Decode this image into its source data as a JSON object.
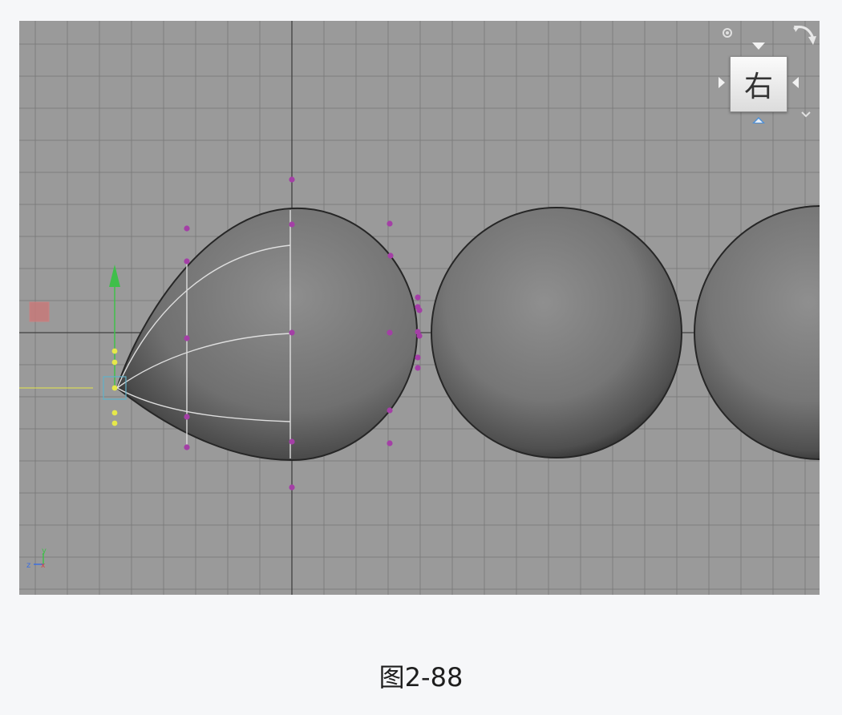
{
  "viewport": {
    "view_label": "右",
    "axis_labels": {
      "y": "y",
      "z": "z",
      "x": "x"
    },
    "colors": {
      "background": "#9a9a9a",
      "grid": "#7d7d7d",
      "axis": "#3f3f3f",
      "control_vertex": "#a43fa6",
      "pivot": "#e6e84a",
      "manipulator_y": "#3fbf4a",
      "selection_box": "#5fb1c9"
    },
    "icons": {
      "home": "home-icon",
      "rotate": "rotate-arrows-icon",
      "menu": "chevron-down-icon",
      "nav_arrows": [
        "arrow-up-icon",
        "arrow-left-icon",
        "arrow-right-icon",
        "arrow-down-icon"
      ]
    }
  },
  "caption": "图2-88"
}
